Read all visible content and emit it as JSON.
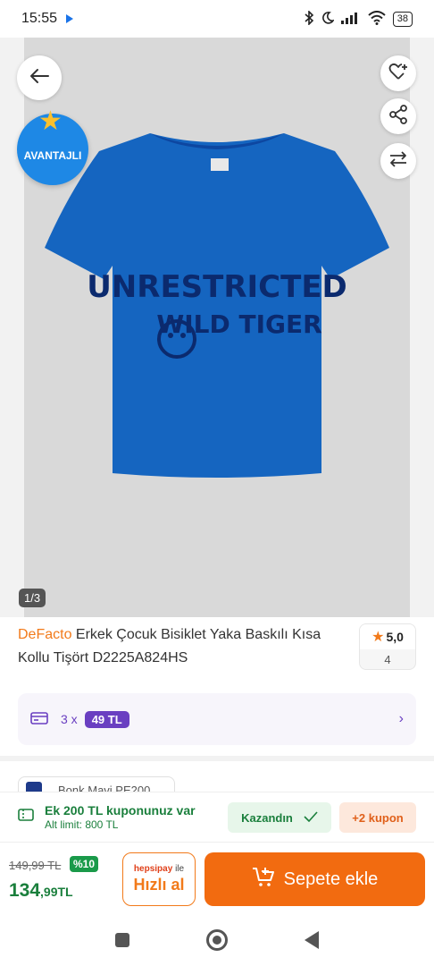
{
  "status": {
    "time": "15:55",
    "battery": "38"
  },
  "gallery": {
    "badge": "AVANTAJLI",
    "page_indicator": "1/3",
    "tshirt_print_line1": "UNRESTRICTED",
    "tshirt_print_line2": "WILD TIGER",
    "tshirt_color": "#1565c0"
  },
  "product": {
    "brand": "DeFacto",
    "title": "Erkek Çocuk Bisiklet Yaka Baskılı Kısa Kollu Tişört D2225A824HS",
    "rating": "5,0",
    "rating_count": "4"
  },
  "installment": {
    "count": "3 x",
    "amount": "49 TL"
  },
  "seller": {
    "name": "Bonk Mavi PE200"
  },
  "coupon": {
    "title": "Ek 200 TL kuponunuz var",
    "subtitle": "Alt limit: 800 TL",
    "won_label": "Kazandın",
    "more_label": "+2 kupon"
  },
  "buy": {
    "old_price": "149,99 TL",
    "discount": "%10",
    "price_int": "134",
    "price_dec": ",99TL",
    "hepsipay_brand": "hepsipay",
    "hepsipay_suffix": "ile",
    "hepsipay_label": "Hızlı al",
    "add_to_cart": "Sepete ekle"
  },
  "colors": {
    "accent": "#f27a1a",
    "green": "#1a7f3c",
    "purple": "#6a3fc1"
  }
}
